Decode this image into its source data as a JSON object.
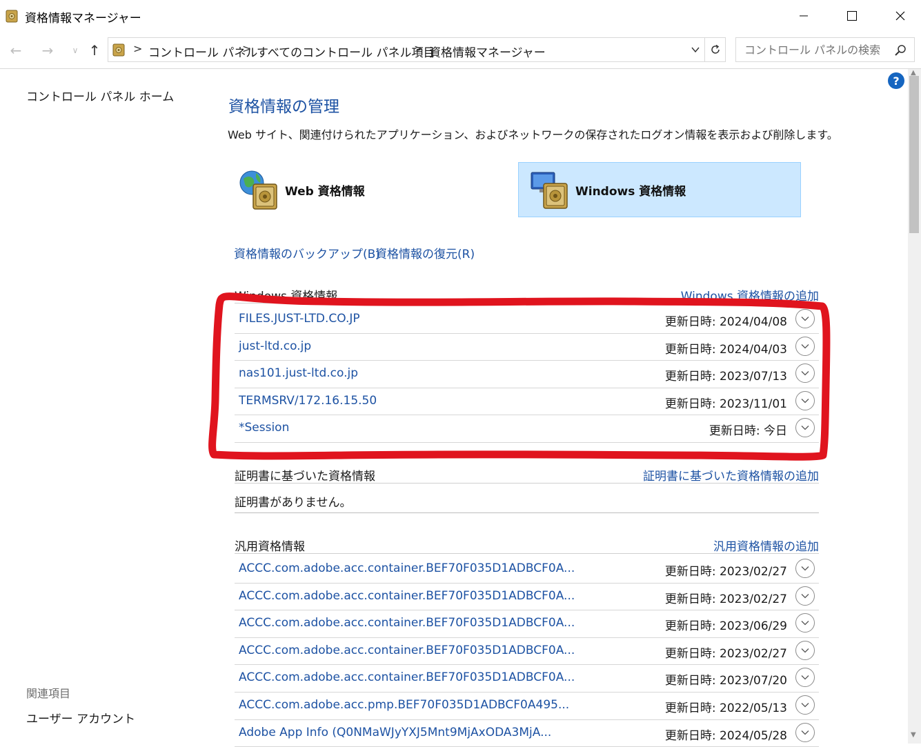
{
  "window": {
    "title": "資格情報マネージャー",
    "min_glyph": "—",
    "max_glyph": "☐",
    "close_glyph": "✕"
  },
  "nav": {
    "back_glyph": "←",
    "forward_glyph": "→",
    "history_glyph": "∨",
    "up_glyph": "↑",
    "breadcrumb": [
      "コントロール パネル",
      "すべてのコントロール パネル項目",
      "資格情報マネージャー"
    ],
    "separator": ">",
    "search_placeholder": "コントロール パネルの検索"
  },
  "sidebar": {
    "home_link": "コントロール パネル ホーム",
    "related_heading": "関連項目",
    "related_link": "ユーザー アカウント"
  },
  "help_glyph": "?",
  "main": {
    "title": "資格情報の管理",
    "description": "Web サイト、関連付けられたアプリケーション、およびネットワークの保存されたログオン情報を表示および削除します。",
    "web_credentials_label": "Web 資格情報",
    "windows_credentials_label": "Windows 資格情報",
    "backup_link": "資格情報のバックアップ(B)",
    "restore_link": "資格情報の復元(R)"
  },
  "windows_section": {
    "title": "Windows 資格情報",
    "add_link": "Windows 資格情報の追加",
    "rows": [
      {
        "name": "FILES.JUST-LTD.CO.JP",
        "date": "更新日時:  2024/04/08"
      },
      {
        "name": "just-ltd.co.jp",
        "date": "更新日時:  2024/04/03"
      },
      {
        "name": "nas101.just-ltd.co.jp",
        "date": "更新日時:  2023/07/13"
      },
      {
        "name": "TERMSRV/172.16.15.50",
        "date": "更新日時:  2023/11/01"
      },
      {
        "name": "*Session",
        "date": "更新日時:  今日"
      }
    ]
  },
  "cert_section": {
    "title": "証明書に基づいた資格情報",
    "add_link": "証明書に基づいた資格情報の追加",
    "empty_text": "証明書がありません。"
  },
  "generic_section": {
    "title": "汎用資格情報",
    "add_link": "汎用資格情報の追加",
    "rows": [
      {
        "name": "ACCC.com.adobe.acc.container.BEF70F035D1ADBCF0A...",
        "date": "更新日時:  2023/02/27"
      },
      {
        "name": "ACCC.com.adobe.acc.container.BEF70F035D1ADBCF0A...",
        "date": "更新日時:  2023/02/27"
      },
      {
        "name": "ACCC.com.adobe.acc.container.BEF70F035D1ADBCF0A...",
        "date": "更新日時:  2023/06/29"
      },
      {
        "name": "ACCC.com.adobe.acc.container.BEF70F035D1ADBCF0A...",
        "date": "更新日時:  2023/02/27"
      },
      {
        "name": "ACCC.com.adobe.acc.container.BEF70F035D1ADBCF0A...",
        "date": "更新日時:  2023/07/20"
      },
      {
        "name": "ACCC.com.adobe.acc.pmp.BEF70F035D1ADBCF0A495...",
        "date": "更新日時:  2022/05/13"
      },
      {
        "name": "Adobe App Info (Q0NMaWJyYXJ5Mnt9MjAxODA3MjA...",
        "date": "更新日時:  2024/05/28"
      }
    ]
  },
  "colors": {
    "link": "#1d52a3",
    "selected_bg": "#cce8ff",
    "annotation": "#e0141e"
  },
  "icons": [
    "credential-manager-icon",
    "globe-safe-icon",
    "computer-safe-icon",
    "refresh-icon",
    "search-icon",
    "help-icon",
    "expand-chevron-icon"
  ]
}
